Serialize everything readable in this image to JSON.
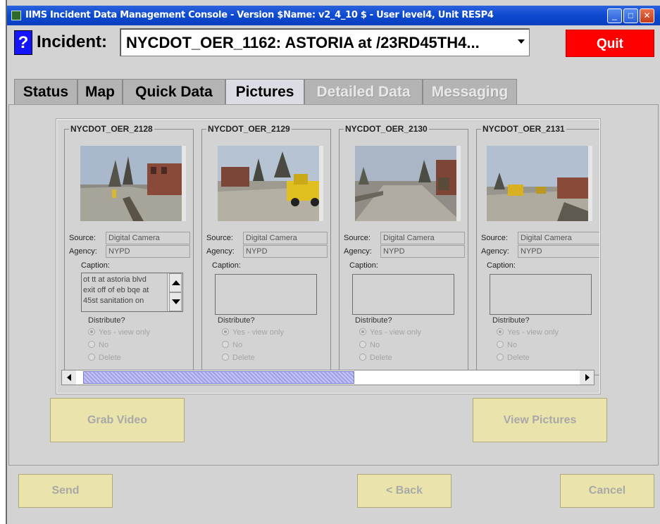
{
  "window": {
    "title": "IIMS Incident Data Management Console - Version $Name: v2_4_10 $  - User level4, Unit RESP4"
  },
  "header": {
    "help_label": "?",
    "incident_label": "Incident:",
    "incident_value": "NYCDOT_OER_1162:  ASTORIA at /23RD45TH4...",
    "quit_label": "Quit"
  },
  "tabs": [
    {
      "label": "Status",
      "state": "normal"
    },
    {
      "label": "Map",
      "state": "normal"
    },
    {
      "label": "Quick Data",
      "state": "normal"
    },
    {
      "label": "Pictures",
      "state": "active"
    },
    {
      "label": "Detailed Data",
      "state": "disabled"
    },
    {
      "label": "Messaging",
      "state": "disabled"
    }
  ],
  "pictures": [
    {
      "id": "NYCDOT_OER_2128",
      "source_label": "Source:",
      "source": "Digital Camera",
      "agency_label": "Agency:",
      "agency": "NYPD",
      "caption_label": "Caption:",
      "caption": "ot tt at astoria blvd\nexit off of eb bqe at\n45st sanitation on",
      "distribute_label": "Distribute?",
      "options": [
        "Yes - view only",
        "No",
        "Delete"
      ],
      "selected": 0
    },
    {
      "id": "NYCDOT_OER_2129",
      "source_label": "Source:",
      "source": "Digital Camera",
      "agency_label": "Agency:",
      "agency": "NYPD",
      "caption_label": "Caption:",
      "caption": "",
      "distribute_label": "Distribute?",
      "options": [
        "Yes - view only",
        "No",
        "Delete"
      ],
      "selected": 0
    },
    {
      "id": "NYCDOT_OER_2130",
      "source_label": "Source:",
      "source": "Digital Camera",
      "agency_label": "Agency:",
      "agency": "NYPD",
      "caption_label": "Caption:",
      "caption": "",
      "distribute_label": "Distribute?",
      "options": [
        "Yes - view only",
        "No",
        "Delete"
      ],
      "selected": 0
    },
    {
      "id": "NYCDOT_OER_2131",
      "source_label": "Source:",
      "source": "Digital Camera",
      "agency_label": "Agency:",
      "agency": "NYPD",
      "caption_label": "Caption:",
      "caption": "",
      "distribute_label": "Distribute?",
      "options": [
        "Yes - view only",
        "No",
        "Delete"
      ],
      "selected": 0
    }
  ],
  "actions": {
    "grab_video": "Grab Video",
    "view_pictures": "View Pictures",
    "send": "Send",
    "back": "< Back",
    "cancel": "Cancel"
  },
  "colors": {
    "titlebar": "#0d49cf",
    "help_button": "#1414ff",
    "quit_button": "#ff0000",
    "action_button_bg": "#eae4ac",
    "scroll_thumb": "#a0a0e8"
  }
}
